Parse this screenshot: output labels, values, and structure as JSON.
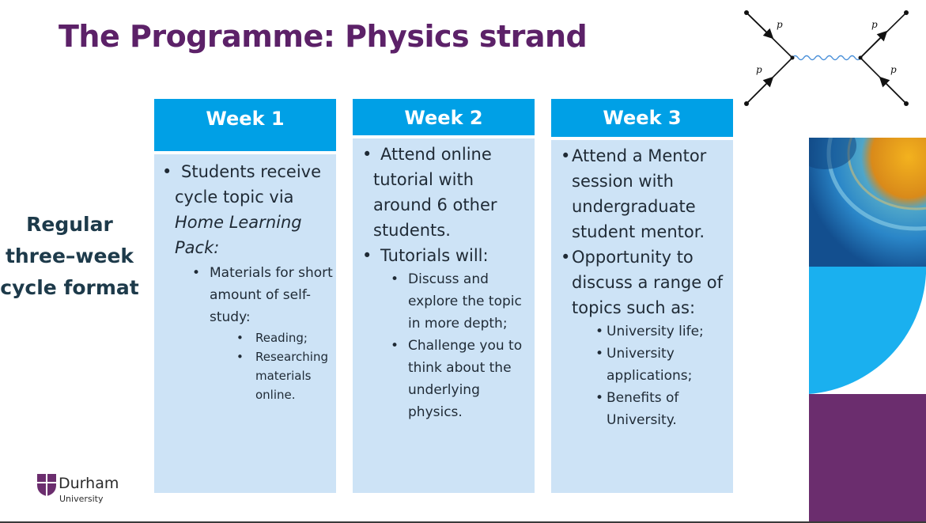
{
  "title": "The Programme: Physics strand",
  "side_label": [
    "Regular",
    "three–week",
    "cycle format"
  ],
  "columns": [
    {
      "heading": "Week 1",
      "bullets": [
        {
          "text": "Students receive cycle topic via",
          "text_italic": "Home Learning Pack:",
          "sub": [
            {
              "text": "Materials for short amount of self-study:",
              "sub": [
                "Reading;",
                "Researching materials online."
              ]
            }
          ]
        }
      ]
    },
    {
      "heading": "Week 2",
      "bullets": [
        {
          "text": "Attend online tutorial with around 6 other students.",
          "sub": []
        },
        {
          "text": "Tutorials will:",
          "sub": [
            "Discuss and explore the topic in more depth;",
            "Challenge you to think about the underlying physics."
          ]
        }
      ]
    },
    {
      "heading": "Week 3",
      "bullets": [
        {
          "text": "Attend a Mentor session with undergraduate student mentor.",
          "sub": []
        },
        {
          "text": "Opportunity to discuss a range of topics such as:",
          "sub": [
            "University life;",
            "University applications;",
            "Benefits of University."
          ]
        }
      ]
    }
  ],
  "feynman_labels": [
    "p",
    "p",
    "p",
    "p"
  ],
  "logo": {
    "name": "Durham",
    "sub": "University"
  },
  "colors": {
    "title": "#5c2168",
    "header_bg": "#00a0e6",
    "body_bg": "#cde3f6",
    "accent_blue": "#1ab0ef",
    "accent_purple": "#6b2d6e"
  }
}
